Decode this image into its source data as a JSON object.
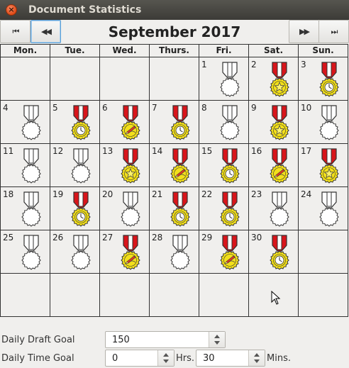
{
  "window": {
    "title": "Document Statistics"
  },
  "nav": {
    "first_icon": "⏮",
    "prev_icon": "◀◀",
    "next_icon": "▶▶",
    "last_icon": "⏭",
    "month_label": "September 2017"
  },
  "weekdays": [
    "Mon.",
    "Tue.",
    "Wed.",
    "Thurs.",
    "Fri.",
    "Sat.",
    "Sun."
  ],
  "weeks": [
    [
      {
        "day": ""
      },
      {
        "day": ""
      },
      {
        "day": ""
      },
      {
        "day": ""
      },
      {
        "day": "1",
        "medal": "none"
      },
      {
        "day": "2",
        "medal": "star"
      },
      {
        "day": "3",
        "medal": "clock"
      }
    ],
    [
      {
        "day": "4",
        "medal": "none"
      },
      {
        "day": "5",
        "medal": "clock"
      },
      {
        "day": "6",
        "medal": "pencil"
      },
      {
        "day": "7",
        "medal": "clock"
      },
      {
        "day": "8",
        "medal": "none"
      },
      {
        "day": "9",
        "medal": "star"
      },
      {
        "day": "10",
        "medal": "none"
      }
    ],
    [
      {
        "day": "11",
        "medal": "none"
      },
      {
        "day": "12",
        "medal": "none"
      },
      {
        "day": "13",
        "medal": "star"
      },
      {
        "day": "14",
        "medal": "pencil"
      },
      {
        "day": "15",
        "medal": "clock"
      },
      {
        "day": "16",
        "medal": "pencil"
      },
      {
        "day": "17",
        "medal": "star"
      }
    ],
    [
      {
        "day": "18",
        "medal": "none"
      },
      {
        "day": "19",
        "medal": "clock"
      },
      {
        "day": "20",
        "medal": "none"
      },
      {
        "day": "21",
        "medal": "clock"
      },
      {
        "day": "22",
        "medal": "clock"
      },
      {
        "day": "23",
        "medal": "none"
      },
      {
        "day": "24",
        "medal": "none"
      }
    ],
    [
      {
        "day": "25",
        "medal": "none"
      },
      {
        "day": "26",
        "medal": "none"
      },
      {
        "day": "27",
        "medal": "pencil"
      },
      {
        "day": "28",
        "medal": "none"
      },
      {
        "day": "29",
        "medal": "pencil"
      },
      {
        "day": "30",
        "medal": "clock"
      },
      {
        "day": ""
      }
    ],
    [
      {
        "day": ""
      },
      {
        "day": ""
      },
      {
        "day": ""
      },
      {
        "day": ""
      },
      {
        "day": ""
      },
      {
        "day": ""
      },
      {
        "day": ""
      }
    ]
  ],
  "goals": {
    "draft_label": "Daily Draft Goal",
    "draft_value": "150",
    "time_label": "Daily Time Goal",
    "hours_value": "0",
    "hours_unit": "Hrs.",
    "minutes_value": "30",
    "minutes_unit": "Mins."
  },
  "colors": {
    "ribbon_red": "#d8151b",
    "medal_gold": "#f3e01a",
    "medal_outline": "#333333"
  }
}
